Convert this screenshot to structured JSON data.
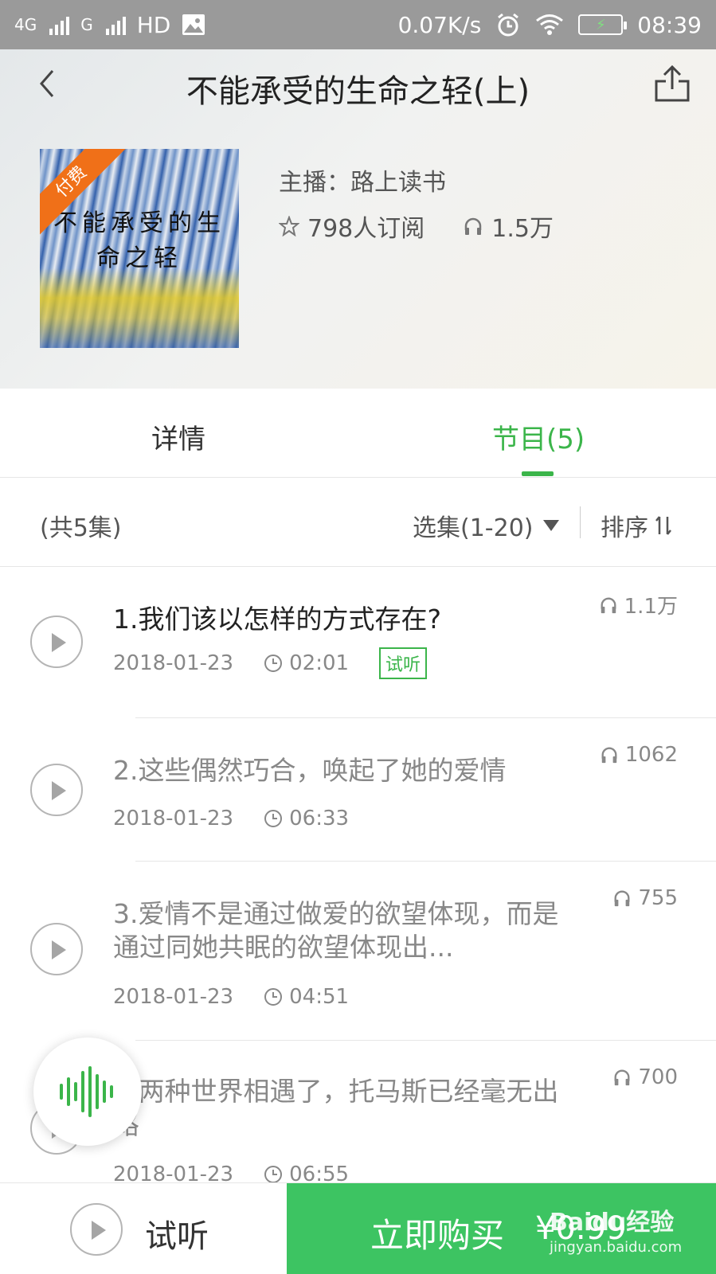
{
  "status_bar": {
    "network_1": "4G",
    "network_2": "G",
    "hd": "HD",
    "speed": "0.07K/s",
    "time": "08:39"
  },
  "header": {
    "title": "不能承受的生命之轻(上)",
    "cover_title": "不能承受的生命之轻",
    "paid_badge": "付费",
    "anchor": "主播：路上读书",
    "subscribers": "798人订阅",
    "plays": "1.5万"
  },
  "tabs": {
    "details": "详情",
    "episodes": "节目(5)"
  },
  "filter": {
    "total": "(共5集)",
    "select": "选集(1-20)",
    "sort": "排序"
  },
  "episodes": [
    {
      "title": "1.我们该以怎样的方式存在?",
      "date": "2018-01-23",
      "duration": "02:01",
      "plays": "1.1万",
      "badge": "试听"
    },
    {
      "title": "2.这些偶然巧合，唤起了她的爱情",
      "date": "2018-01-23",
      "duration": "06:33",
      "plays": "1062"
    },
    {
      "title": "3.爱情不是通过做爱的欲望体现，而是通过同她共眠的欲望体现出...",
      "date": "2018-01-23",
      "duration": "04:51",
      "plays": "755"
    },
    {
      "title": "4.两种世界相遇了，托马斯已经毫无出路",
      "date": "2018-01-23",
      "duration": "06:55",
      "plays": "700"
    }
  ],
  "bottom": {
    "trial": "试听",
    "buy": "立即购买",
    "price": "¥0.99"
  },
  "watermark": {
    "brand": "Baidu经验",
    "url": "jingyan.baidu.com"
  },
  "colors": {
    "accent": "#3bb54a",
    "buy": "#3dc462",
    "paid": "#f07018"
  }
}
